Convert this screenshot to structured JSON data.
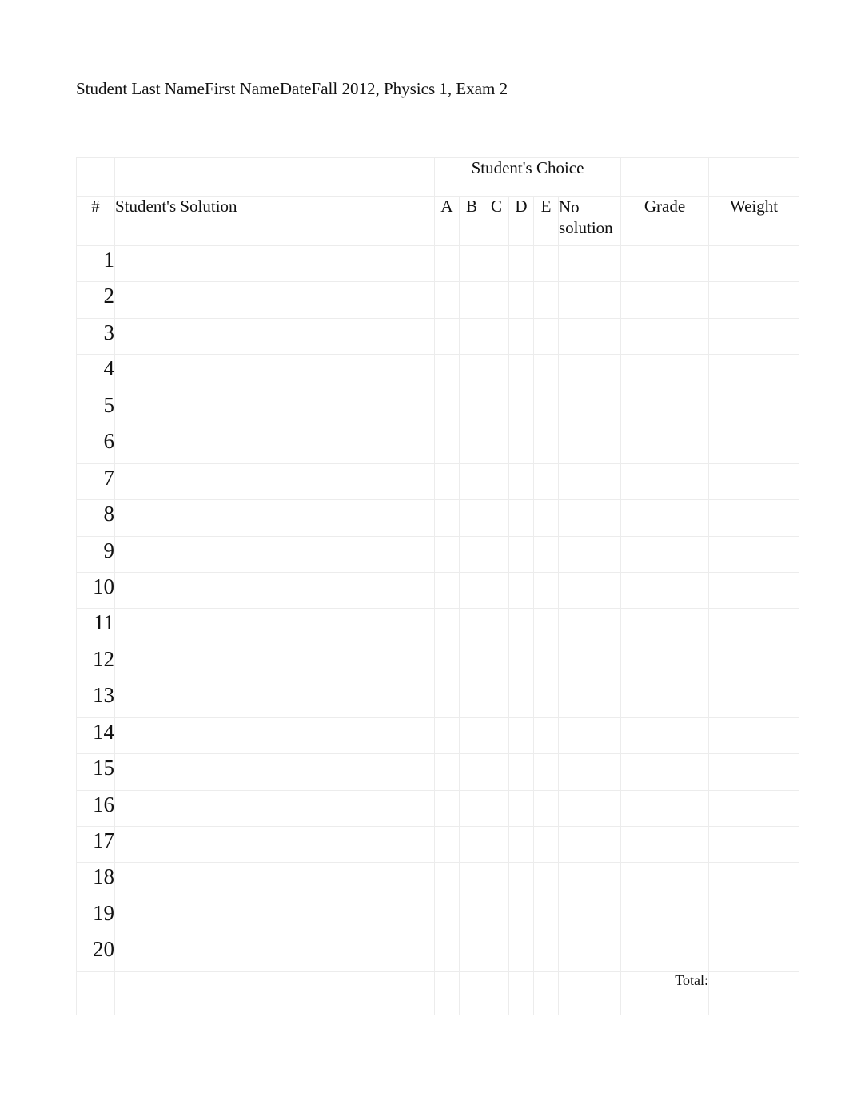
{
  "header": {
    "last_name_label": "Student Last Name",
    "first_name_label": "First Name",
    "date_label": "Date",
    "exam_label": "Fall 2012, Physics 1, Exam 2"
  },
  "table": {
    "group_header": "Student's Choice",
    "columns": {
      "number": "#",
      "solution": "Student's Solution",
      "choice_a": "A",
      "choice_b": "B",
      "choice_c": "C",
      "choice_d": "D",
      "choice_e": "E",
      "no_solution": "No solution",
      "grade": "Grade",
      "weight": "Weight"
    },
    "rows": [
      {
        "number": "1",
        "solution": "",
        "a": "",
        "b": "",
        "c": "",
        "d": "",
        "e": "",
        "no_solution": "",
        "grade": "",
        "weight": ""
      },
      {
        "number": "2",
        "solution": "",
        "a": "",
        "b": "",
        "c": "",
        "d": "",
        "e": "",
        "no_solution": "",
        "grade": "",
        "weight": ""
      },
      {
        "number": "3",
        "solution": "",
        "a": "",
        "b": "",
        "c": "",
        "d": "",
        "e": "",
        "no_solution": "",
        "grade": "",
        "weight": ""
      },
      {
        "number": "4",
        "solution": "",
        "a": "",
        "b": "",
        "c": "",
        "d": "",
        "e": "",
        "no_solution": "",
        "grade": "",
        "weight": ""
      },
      {
        "number": "5",
        "solution": "",
        "a": "",
        "b": "",
        "c": "",
        "d": "",
        "e": "",
        "no_solution": "",
        "grade": "",
        "weight": ""
      },
      {
        "number": "6",
        "solution": "",
        "a": "",
        "b": "",
        "c": "",
        "d": "",
        "e": "",
        "no_solution": "",
        "grade": "",
        "weight": ""
      },
      {
        "number": "7",
        "solution": "",
        "a": "",
        "b": "",
        "c": "",
        "d": "",
        "e": "",
        "no_solution": "",
        "grade": "",
        "weight": ""
      },
      {
        "number": "8",
        "solution": "",
        "a": "",
        "b": "",
        "c": "",
        "d": "",
        "e": "",
        "no_solution": "",
        "grade": "",
        "weight": ""
      },
      {
        "number": "9",
        "solution": "",
        "a": "",
        "b": "",
        "c": "",
        "d": "",
        "e": "",
        "no_solution": "",
        "grade": "",
        "weight": ""
      },
      {
        "number": "10",
        "solution": "",
        "a": "",
        "b": "",
        "c": "",
        "d": "",
        "e": "",
        "no_solution": "",
        "grade": "",
        "weight": ""
      },
      {
        "number": "11",
        "solution": "",
        "a": "",
        "b": "",
        "c": "",
        "d": "",
        "e": "",
        "no_solution": "",
        "grade": "",
        "weight": ""
      },
      {
        "number": "12",
        "solution": "",
        "a": "",
        "b": "",
        "c": "",
        "d": "",
        "e": "",
        "no_solution": "",
        "grade": "",
        "weight": ""
      },
      {
        "number": "13",
        "solution": "",
        "a": "",
        "b": "",
        "c": "",
        "d": "",
        "e": "",
        "no_solution": "",
        "grade": "",
        "weight": ""
      },
      {
        "number": "14",
        "solution": "",
        "a": "",
        "b": "",
        "c": "",
        "d": "",
        "e": "",
        "no_solution": "",
        "grade": "",
        "weight": ""
      },
      {
        "number": "15",
        "solution": "",
        "a": "",
        "b": "",
        "c": "",
        "d": "",
        "e": "",
        "no_solution": "",
        "grade": "",
        "weight": ""
      },
      {
        "number": "16",
        "solution": "",
        "a": "",
        "b": "",
        "c": "",
        "d": "",
        "e": "",
        "no_solution": "",
        "grade": "",
        "weight": ""
      },
      {
        "number": "17",
        "solution": "",
        "a": "",
        "b": "",
        "c": "",
        "d": "",
        "e": "",
        "no_solution": "",
        "grade": "",
        "weight": ""
      },
      {
        "number": "18",
        "solution": "",
        "a": "",
        "b": "",
        "c": "",
        "d": "",
        "e": "",
        "no_solution": "",
        "grade": "",
        "weight": ""
      },
      {
        "number": "19",
        "solution": "",
        "a": "",
        "b": "",
        "c": "",
        "d": "",
        "e": "",
        "no_solution": "",
        "grade": "",
        "weight": ""
      },
      {
        "number": "20",
        "solution": "",
        "a": "",
        "b": "",
        "c": "",
        "d": "",
        "e": "",
        "no_solution": "",
        "grade": "",
        "weight": ""
      }
    ],
    "total_label": "Total:",
    "total_value": ""
  },
  "colors": {
    "page_background": "#ffffff",
    "text": "#111111",
    "gridline": "#ececec"
  }
}
